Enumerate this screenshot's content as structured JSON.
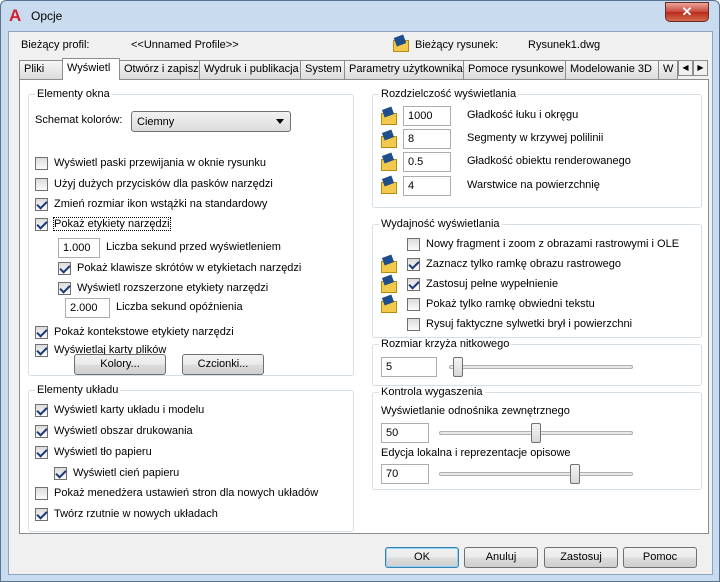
{
  "window": {
    "title": "Opcje",
    "close_glyph": "✕"
  },
  "profile": {
    "profile_label": "Bieżący profil:",
    "profile_value": "<<Unnamed Profile>>",
    "drawing_label": "Bieżący rysunek:",
    "drawing_value": "Rysunek1.dwg"
  },
  "tabs": [
    "Pliki",
    "Wyświetl",
    "Otwórz i zapisz",
    "Wydruk i publikacja",
    "System",
    "Parametry użytkownika",
    "Pomoce rysunkowe",
    "Modelowanie 3D",
    "W"
  ],
  "active_tab": "Wyświetl",
  "tab_scroll": {
    "left": "◀",
    "right": "▶"
  },
  "window_elements": {
    "title": "Elementy okna",
    "color_scheme_label": "Schemat kolorów:",
    "color_scheme_value": "Ciemny",
    "checkboxes": [
      {
        "label": "Wyświetl paski przewijania w oknie rysunku",
        "checked": false
      },
      {
        "label": "Użyj dużych przycisków dla pasków narzędzi",
        "checked": false
      },
      {
        "label": "Zmień rozmiar ikon wstążki na standardowy",
        "checked": true
      },
      {
        "label": "Pokaż etykiety narzędzi",
        "checked": true
      }
    ],
    "seconds_before_value": "1.000",
    "seconds_before_label": "Liczba sekund przed wyświetleniem",
    "show_shortcuts_label": "Pokaż klawisze skrótów w etykietach narzędzi",
    "show_shortcuts_checked": true,
    "extended_tooltips_label": "Wyświetl rozszerzone etykiety narzędzi",
    "extended_tooltips_checked": true,
    "delay_value": "2.000",
    "delay_label": "Liczba sekund opóźnienia",
    "rollover_label": "Pokaż kontekstowe etykiety narzędzi",
    "rollover_checked": true,
    "file_tabs_label": "Wyświetlaj karty plików",
    "file_tabs_checked": true,
    "colors_button": "Kolory...",
    "fonts_button": "Czcionki..."
  },
  "layout_elements": {
    "title": "Elementy układu",
    "checkboxes": [
      {
        "label": "Wyświetl karty układu i modelu",
        "checked": true
      },
      {
        "label": "Wyświetl obszar drukowania",
        "checked": true
      },
      {
        "label": "Wyświetl tło papieru",
        "checked": true
      },
      {
        "label": "Wyświetl cień papieru",
        "checked": true
      },
      {
        "label": "Pokaż menedżera ustawień stron dla nowych układów",
        "checked": false
      },
      {
        "label": "Twórz rzutnie w nowych układach",
        "checked": true
      }
    ]
  },
  "display_resolution": {
    "title": "Rozdzielczość wyświetlania",
    "rows": [
      {
        "value": "1000",
        "label": "Gładkość łuku i okręgu"
      },
      {
        "value": "8",
        "label": "Segmenty w krzywej polilinii"
      },
      {
        "value": "0.5",
        "label": "Gładkość obiektu renderowanego"
      },
      {
        "value": "4",
        "label": "Warstwice na powierzchnię"
      }
    ]
  },
  "display_performance": {
    "title": "Wydajność wyświetlania",
    "checkboxes": [
      {
        "label": "Nowy fragment i zoom z obrazami rastrowymi i OLE",
        "checked": false
      },
      {
        "label": "Zaznacz tylko ramkę obrazu rastrowego",
        "checked": true
      },
      {
        "label": "Zastosuj pełne wypełnienie",
        "checked": true
      },
      {
        "label": "Pokaż tylko ramkę obwiedni tekstu",
        "checked": false
      },
      {
        "label": "Rysuj faktyczne sylwetki brył i powierzchni",
        "checked": false
      }
    ]
  },
  "crosshair": {
    "title": "Rozmiar krzyża nitkowego",
    "value": "5",
    "slider_fraction": 0.05
  },
  "fade_control": {
    "title": "Kontrola wygaszenia",
    "xref_label": "Wyświetlanie odnośnika zewnętrznego",
    "xref_value": "50",
    "xref_fraction": 0.5,
    "inplace_label": "Edycja lokalna i reprezentacje opisowe",
    "inplace_value": "70",
    "inplace_fraction": 0.7
  },
  "buttons": {
    "ok": "OK",
    "cancel": "Anuluj",
    "apply": "Zastosuj",
    "help": "Pomoc"
  },
  "colors": {
    "title_icon": "#d0202a",
    "close": "#c9473a"
  }
}
